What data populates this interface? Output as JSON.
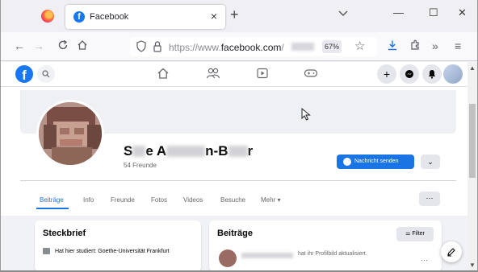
{
  "browser": {
    "tab_title": "Facebook",
    "tab_close": "×",
    "new_tab": "+",
    "url_prefix": "https://www.",
    "url_host": "facebook.com",
    "url_suffix": "/",
    "zoom": "67%"
  },
  "facebook": {
    "logo_letter": "f"
  },
  "profile": {
    "name_parts": [
      "S",
      "e A",
      "n-B",
      "r"
    ],
    "friends": "54 Freunde",
    "message_button": "Nachricht senden",
    "more_button": "⌄"
  },
  "tabs": [
    "Beiträge",
    "Info",
    "Freunde",
    "Fotos",
    "Videos",
    "Besuche",
    "Mehr ▾"
  ],
  "tab_more": "···",
  "steckbrief": {
    "title": "Steckbrief",
    "line": "Hat hier studiert: Goethe-Universität Frankfurt"
  },
  "posts": {
    "title": "Beiträge",
    "filter_label": "Filter",
    "post_text": "hat ihr Profilbild aktualisiert.",
    "post_more": "···"
  },
  "colors": {
    "fb_blue": "#1877f2",
    "button_blue": "#1b74e4"
  }
}
